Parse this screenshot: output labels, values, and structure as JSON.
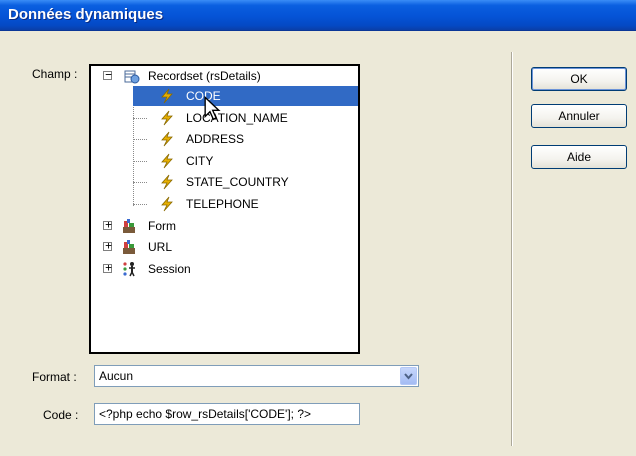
{
  "window": {
    "title": "Données dynamiques"
  },
  "labels": {
    "field": "Champ :",
    "format": "Format :",
    "code": "Code :"
  },
  "tree": {
    "recordset": {
      "label": "Recordset (rsDetails)",
      "expander": "−",
      "icon": "recordset-icon",
      "fields": [
        "CODE",
        "LOCATION_NAME",
        "ADDRESS",
        "CITY",
        "STATE_COUNTRY",
        "TELEPHONE"
      ],
      "selected": "CODE"
    },
    "nodes": [
      {
        "label": "Form",
        "expander": "+",
        "icon": "form-icon"
      },
      {
        "label": "URL",
        "expander": "+",
        "icon": "url-icon"
      },
      {
        "label": "Session",
        "expander": "+",
        "icon": "session-icon"
      }
    ]
  },
  "format": {
    "value": "Aucun"
  },
  "code": {
    "value": "<?php echo $row_rsDetails['CODE']; ?>"
  },
  "buttons": {
    "ok": "OK",
    "cancel": "Annuler",
    "help": "Aide"
  },
  "colors": {
    "title_bar": "#0553d6",
    "selection": "#316ac5",
    "dialog_bg": "#ece9d8",
    "field_icon": "#e8b000"
  }
}
